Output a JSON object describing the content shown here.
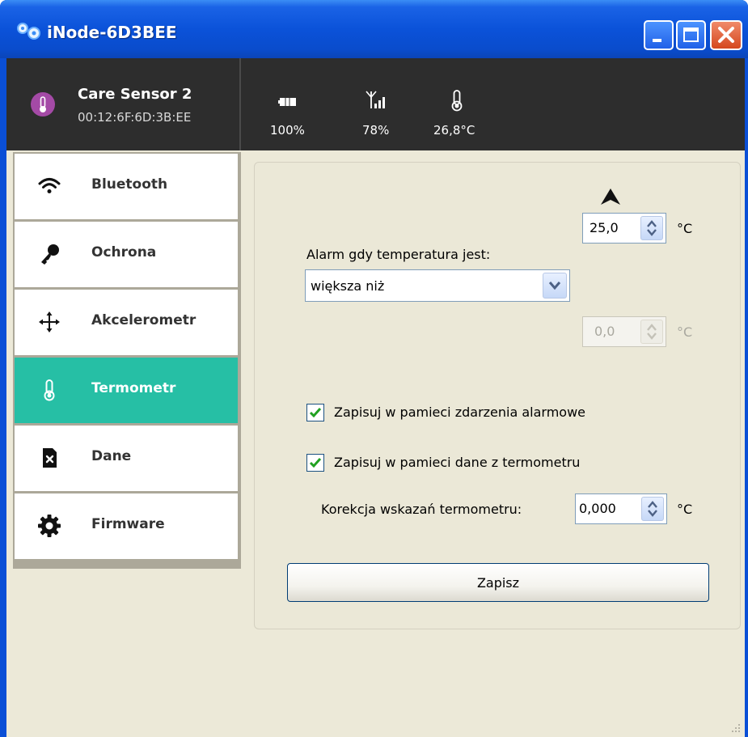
{
  "window": {
    "title": "iNode-6D3BEE"
  },
  "header": {
    "device_name": "Care Sensor 2",
    "device_mac": "00:12:6F:6D:3B:EE",
    "stats": [
      {
        "icon": "battery-icon",
        "value": "100%"
      },
      {
        "icon": "signal-icon",
        "value": "78%"
      },
      {
        "icon": "thermometer-icon",
        "value": "26,8°C"
      }
    ]
  },
  "sidebar": {
    "items": [
      {
        "label": "Bluetooth",
        "icon": "wifi-icon",
        "active": false
      },
      {
        "label": "Ochrona",
        "icon": "key-icon",
        "active": false
      },
      {
        "label": "Akcelerometr",
        "icon": "move-arrows-icon",
        "active": false
      },
      {
        "label": "Termometr",
        "icon": "thermometer-icon",
        "active": true
      },
      {
        "label": "Dane",
        "icon": "sd-card-icon",
        "active": false
      },
      {
        "label": "Firmware",
        "icon": "gear-icon",
        "active": false
      }
    ]
  },
  "thermometer": {
    "upper_value": "25,0",
    "upper_unit": "°C",
    "alarm_label": "Alarm gdy temperatura jest:",
    "condition_selected": "większa niż",
    "lower_value": "0,0",
    "lower_unit": "°C",
    "log_alarm_events_label": "Zapisuj w pamieci zdarzenia alarmowe",
    "log_alarm_events_checked": true,
    "log_thermo_data_label": "Zapisuj w pamieci dane z termometru",
    "log_thermo_data_checked": true,
    "correction_label": "Korekcja wskazań  termometru:",
    "correction_value": "0,000",
    "correction_unit": "°C",
    "save_label": "Zapisz"
  },
  "colors": {
    "accent": "#26bfa5",
    "header_bg": "#2d2d2d",
    "titlebar": "#0b52d9"
  }
}
